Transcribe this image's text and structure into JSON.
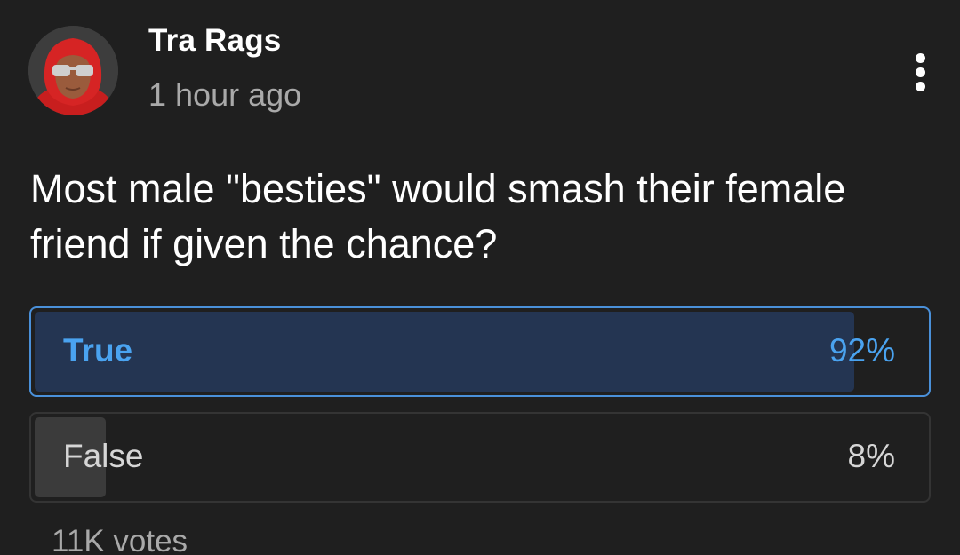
{
  "post": {
    "author": "Tra Rags",
    "time": "1 hour ago",
    "question": "Most male \"besties\" would smash their female friend if given the chance?",
    "more_icon": "more-vertical-icon"
  },
  "poll": {
    "options": [
      {
        "label": "True",
        "percent_text": "92%",
        "share": 0.92,
        "selected": true
      },
      {
        "label": "False",
        "percent_text": "8%",
        "share": 0.08,
        "selected": false
      }
    ],
    "votes": "11K votes"
  },
  "colors": {
    "background": "#1f1f1f",
    "accent": "#4aa3f0",
    "selected_fill": "#243552",
    "unselected_fill": "#3b3b3b"
  }
}
